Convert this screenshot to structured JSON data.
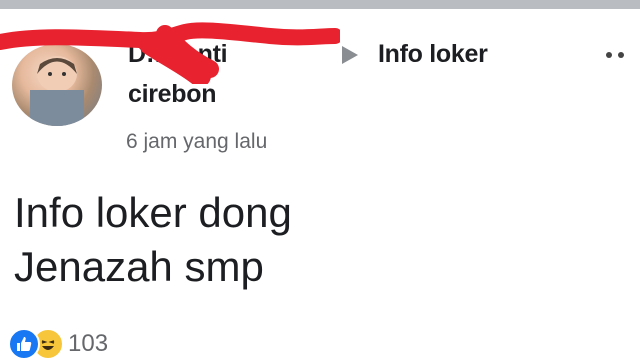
{
  "post": {
    "author_line1": "D…yanti",
    "group_name": "Info loker",
    "author_line2": "cirebon",
    "timestamp": "6 jam yang lalu",
    "body_lines": [
      "Info loker dong",
      "Jenazah smp"
    ],
    "reaction_count": "103"
  },
  "icons": {
    "separator": "triangle-right-icon",
    "more": "more-options-icon",
    "like": "like-icon",
    "haha": "haha-icon"
  },
  "colors": {
    "redaction": "#e8222e",
    "like": "#1877f2",
    "haha": "#f7c63b",
    "secondary_text": "#65676b"
  }
}
